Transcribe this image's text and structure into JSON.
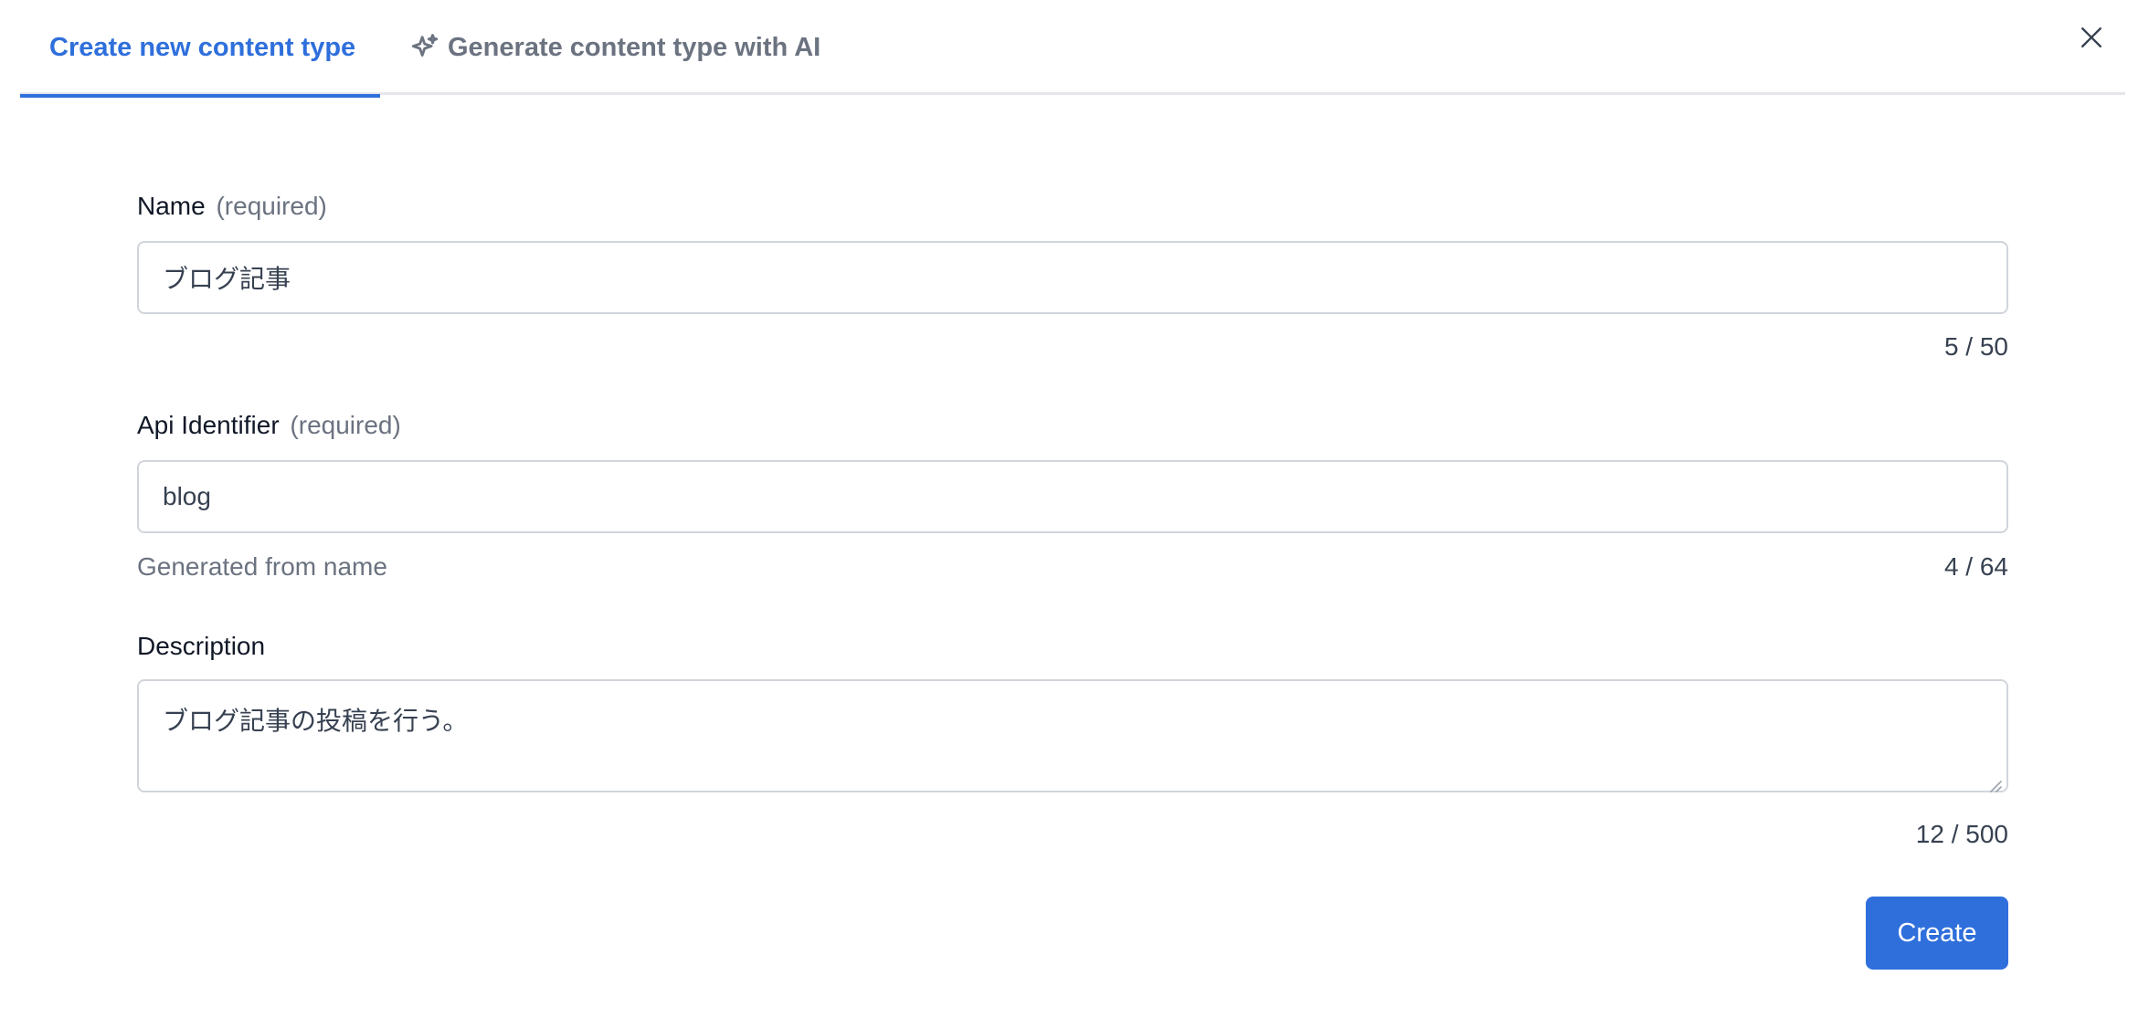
{
  "tabs": {
    "create_label": "Create new content type",
    "ai_label": "Generate content type with AI"
  },
  "form": {
    "name": {
      "label": "Name",
      "required": "(required)",
      "value": "ブログ記事",
      "counter": "5 / 50"
    },
    "api_identifier": {
      "label": "Api Identifier",
      "required": "(required)",
      "value": "blog",
      "hint": "Generated from name",
      "counter": "4 / 64"
    },
    "description": {
      "label": "Description",
      "value": "ブログ記事の投稿を行う。",
      "counter": "12 / 500"
    }
  },
  "actions": {
    "create_label": "Create"
  },
  "colors": {
    "accent": "#2f6fdc",
    "muted": "#6b7280",
    "border": "#d1d5db"
  },
  "icons": {
    "ai": "sparkles-icon",
    "close": "close-icon"
  }
}
